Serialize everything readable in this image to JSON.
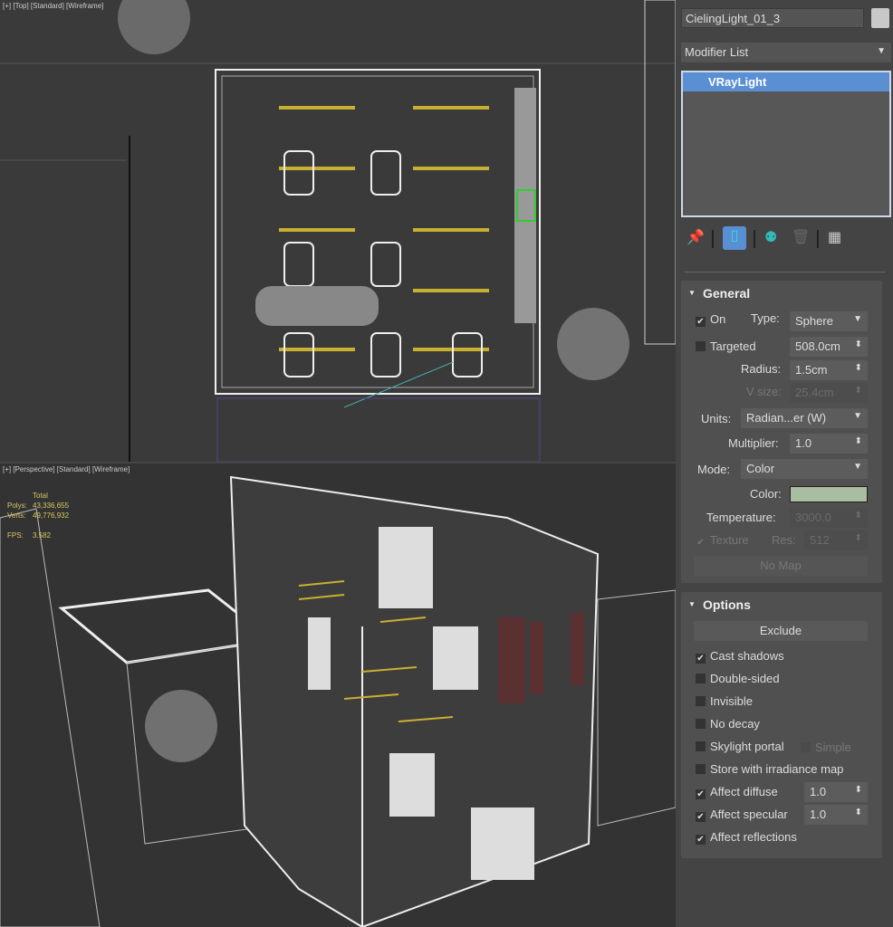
{
  "viewport_top": {
    "label": "[+] [Top] [Standard] [Wireframe]"
  },
  "viewport_persp": {
    "label": "[+] [Perspective] [Standard] [Wireframe]",
    "stats": {
      "header": "Total",
      "polys_label": "Polys:",
      "polys": "43,336,655",
      "verts_label": "Verts:",
      "verts": "49,776,932",
      "fps_label": "FPS:",
      "fps": "3.582"
    }
  },
  "panel": {
    "object_name": "CielingLight_01_3",
    "object_color": "#c8c8c8",
    "modifier_list": "Modifier List",
    "stack": [
      "VRayLight"
    ],
    "general": {
      "title": "General",
      "on_label": "On",
      "on": true,
      "type_label": "Type:",
      "type": "Sphere",
      "targeted_label": "Targeted",
      "targeted": false,
      "target_distance": "508.0cm",
      "radius_label": "Radius:",
      "radius": "1.5cm",
      "vsize_label": "V size:",
      "vsize": "25.4cm",
      "units_label": "Units:",
      "units": "Radian...er (W)",
      "multiplier_label": "Multiplier:",
      "multiplier": "1.0",
      "mode_label": "Mode:",
      "mode": "Color",
      "color_label": "Color:",
      "color": "#a9bda0",
      "temperature_label": "Temperature:",
      "temperature": "3000.0",
      "texture_label": "Texture",
      "res_label": "Res:",
      "res": "512",
      "nomap": "No Map"
    },
    "options": {
      "title": "Options",
      "exclude": "Exclude",
      "items": [
        {
          "label": "Cast shadows",
          "checked": true
        },
        {
          "label": "Double-sided",
          "checked": false
        },
        {
          "label": "Invisible",
          "checked": false
        },
        {
          "label": "No decay",
          "checked": false
        },
        {
          "label": "Skylight portal",
          "checked": false
        },
        {
          "label": "Store with irradiance map",
          "checked": false
        },
        {
          "label": "Affect diffuse",
          "checked": true,
          "value": "1.0"
        },
        {
          "label": "Affect specular",
          "checked": true,
          "value": "1.0"
        },
        {
          "label": "Affect reflections",
          "checked": true
        }
      ],
      "simple_label": "Simple"
    }
  }
}
